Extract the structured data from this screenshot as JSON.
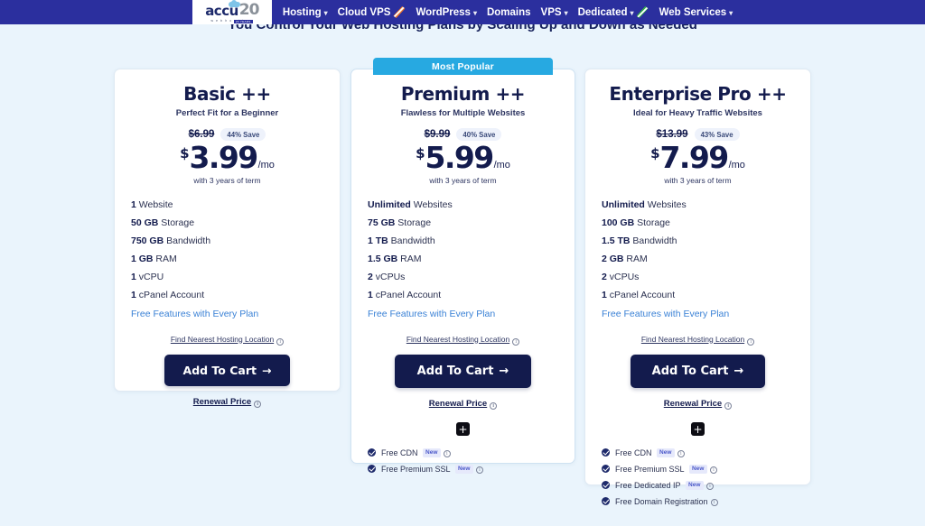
{
  "nav": {
    "logo": {
      "name_main": "accu",
      "anniversary": "20",
      "tagline": "w e b   h o s t i n g",
      "badge": "20 YEARS"
    },
    "items": [
      {
        "label": "Hosting",
        "caret": true,
        "ribbon": "none"
      },
      {
        "label": "Cloud VPS",
        "caret": false,
        "ribbon": "orange"
      },
      {
        "label": "WordPress",
        "caret": true,
        "ribbon": "none"
      },
      {
        "label": "Domains",
        "caret": false,
        "ribbon": "none"
      },
      {
        "label": "VPS",
        "caret": true,
        "ribbon": "none"
      },
      {
        "label": "Dedicated",
        "caret": true,
        "ribbon": "green"
      },
      {
        "label": "Web Services",
        "caret": true,
        "ribbon": "none"
      }
    ]
  },
  "headline": "You Control Your Web Hosting Plans by Scaling Up and Down as Needed",
  "popular_badge": "Most Popular",
  "colors": {
    "page_background": "#eaf4fc",
    "nav_background": "#2b2f9e",
    "brand_navy": "#131b4d",
    "accent_blue": "#27a9e1",
    "link_blue": "#3b82d6",
    "new_badge_text": "#4a57c9",
    "new_badge_bg": "#e6e9fb"
  },
  "common": {
    "nearest_label": "Find Nearest Hosting Location",
    "cart_label": "Add To Cart",
    "cart_arrow": "→",
    "renewal_label": "Renewal Price",
    "free_features_link": "Free Features with Every Plan",
    "plus_label": "+",
    "currency": "$",
    "per_label": "/mo",
    "new_label": "New"
  },
  "plans": [
    {
      "id": "basic",
      "name": "Basic ++",
      "tagline": "Perfect Fit for a Beginner",
      "old_price": "$6.99",
      "save": "44% Save",
      "price": "3.99",
      "term": "with 3 years of term",
      "features": [
        {
          "bold": "1",
          "rest": " Website"
        },
        {
          "bold": "50 GB",
          "rest": " Storage"
        },
        {
          "bold": "750 GB",
          "rest": " Bandwidth"
        },
        {
          "bold": "1 GB",
          "rest": " RAM"
        },
        {
          "bold": "1",
          "rest": " vCPU"
        },
        {
          "bold": "1",
          "rest": " cPanel Account"
        }
      ],
      "free_items": []
    },
    {
      "id": "premium",
      "name": "Premium ++",
      "tagline": "Flawless for Multiple Websites",
      "old_price": "$9.99",
      "save": "40% Save",
      "price": "5.99",
      "term": "with 3 years of term",
      "features": [
        {
          "bold": "Unlimited",
          "rest": " Websites"
        },
        {
          "bold": "75 GB",
          "rest": " Storage"
        },
        {
          "bold": "1 TB",
          "rest": " Bandwidth"
        },
        {
          "bold": "1.5 GB",
          "rest": " RAM"
        },
        {
          "bold": "2",
          "rest": " vCPUs"
        },
        {
          "bold": "1",
          "rest": " cPanel Account"
        }
      ],
      "free_items": [
        {
          "label": "Free CDN",
          "badge": "New"
        },
        {
          "label": "Free Premium SSL",
          "badge": "New"
        }
      ]
    },
    {
      "id": "enterprise",
      "name": "Enterprise Pro ++",
      "tagline": "Ideal for Heavy Traffic Websites",
      "old_price": "$13.99",
      "save": "43% Save",
      "price": "7.99",
      "term": "with 3 years of term",
      "features": [
        {
          "bold": "Unlimited",
          "rest": " Websites"
        },
        {
          "bold": "100 GB",
          "rest": " Storage"
        },
        {
          "bold": "1.5 TB",
          "rest": " Bandwidth"
        },
        {
          "bold": "2 GB",
          "rest": " RAM"
        },
        {
          "bold": "2",
          "rest": " vCPUs"
        },
        {
          "bold": "1",
          "rest": " cPanel Account"
        }
      ],
      "free_items": [
        {
          "label": "Free CDN",
          "badge": "New"
        },
        {
          "label": "Free Premium SSL",
          "badge": "New"
        },
        {
          "label": "Free Dedicated IP",
          "badge": "New"
        },
        {
          "label": "Free Domain Registration",
          "badge": ""
        }
      ]
    }
  ]
}
